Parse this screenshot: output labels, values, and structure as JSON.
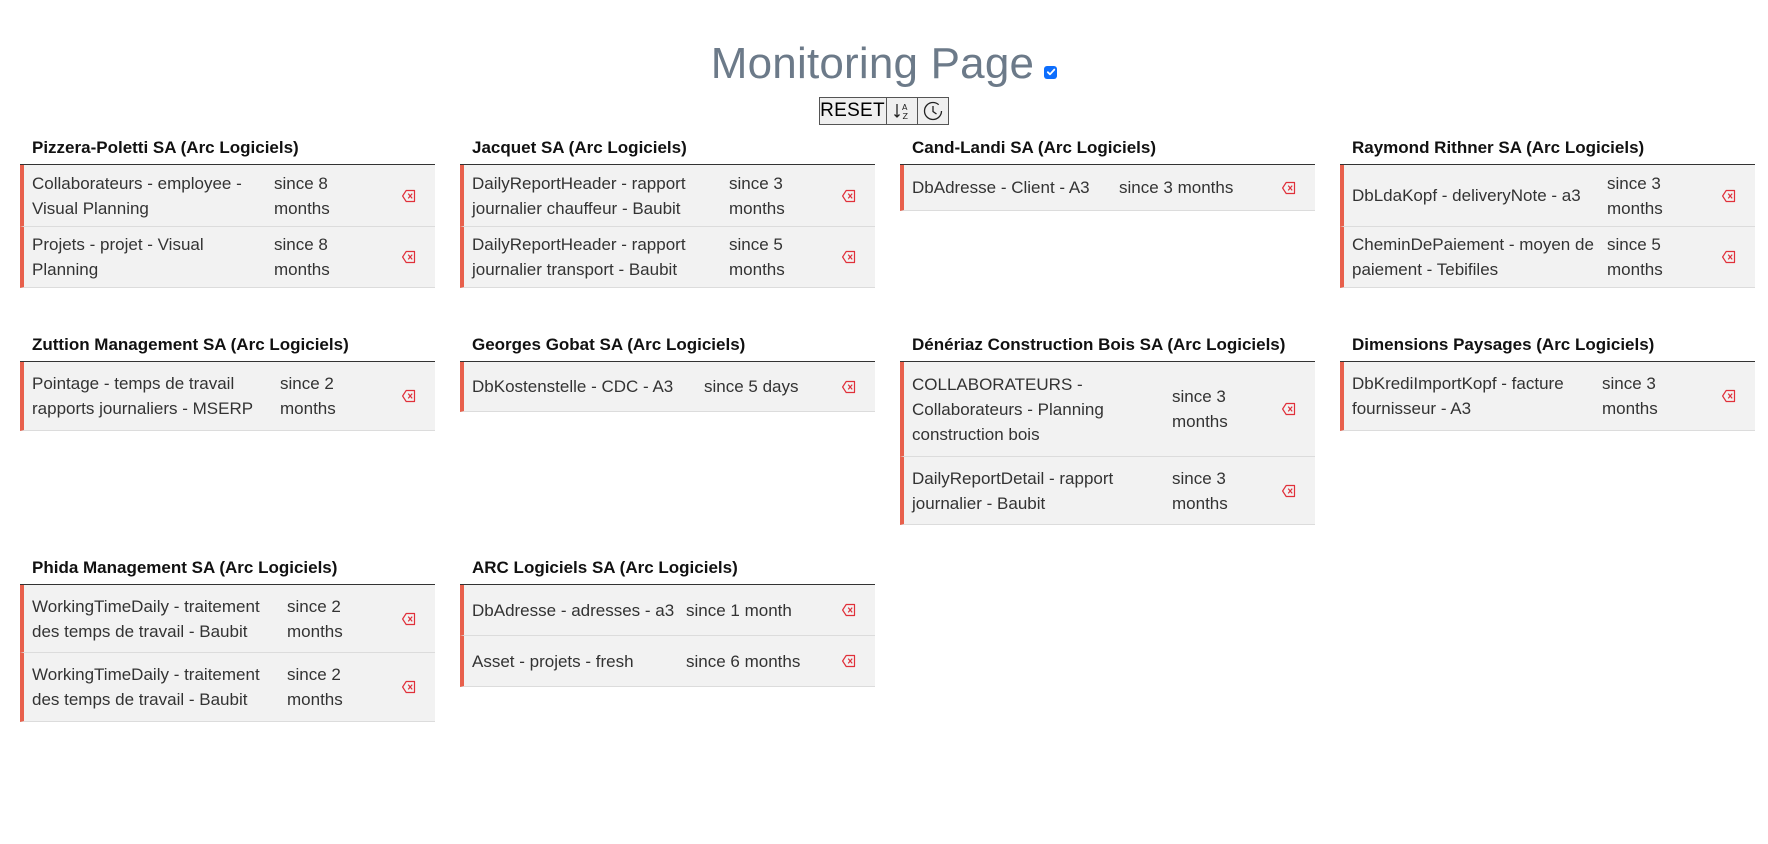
{
  "header": {
    "title": "Monitoring Page",
    "checkbox_checked": true,
    "reset_label": "RESET",
    "sort_icon": "sort-alpha-icon",
    "clock_icon": "clock-icon"
  },
  "colors": {
    "accent": "#e8604c",
    "title": "#6c7a89",
    "checkbox": "#0d6efd",
    "row_bg": "#f2f2f2"
  },
  "panels": [
    {
      "title": "Pizzera-Poletti SA (Arc Logiciels)",
      "items": [
        {
          "name": "Collaborateurs - employee - Visual Planning",
          "since": "since 8 months"
        },
        {
          "name": "Projets - projet - Visual Planning",
          "since": "since 8 months"
        }
      ]
    },
    {
      "title": "Jacquet SA (Arc Logiciels)",
      "items": [
        {
          "name": "DailyReportHeader - rapport journalier chauffeur - Baubit",
          "since": "since 3 months"
        },
        {
          "name": "DailyReportHeader - rapport journalier transport - Baubit",
          "since": "since 5 months"
        }
      ]
    },
    {
      "title": "Cand-Landi SA (Arc Logiciels)",
      "items": [
        {
          "name": "DbAdresse - Client - A3",
          "since": "since 3 months"
        }
      ]
    },
    {
      "title": "Raymond Rithner SA (Arc Logiciels)",
      "items": [
        {
          "name": "DbLdaKopf - deliveryNote - a3",
          "since": "since 3 months"
        },
        {
          "name": "CheminDePaiement - moyen de paiement - Tebifiles",
          "since": "since 5 months"
        }
      ]
    },
    {
      "title": "Zuttion Management SA (Arc Logiciels)",
      "items": [
        {
          "name": "Pointage - temps de travail rapports journaliers - MSERP",
          "since": "since 2 months"
        }
      ]
    },
    {
      "title": "Georges Gobat SA (Arc Logiciels)",
      "items": [
        {
          "name": "DbKostenstelle - CDC - A3",
          "since": "since 5 days"
        }
      ]
    },
    {
      "title": "Dénériaz Construction Bois SA (Arc Logiciels)",
      "items": [
        {
          "name": "COLLABORATEURS - Collaborateurs - Planning construction bois",
          "since": "since 3 months"
        },
        {
          "name": "DailyReportDetail - rapport journalier - Baubit",
          "since": "since 3 months"
        }
      ]
    },
    {
      "title": "Dimensions Paysages (Arc Logiciels)",
      "items": [
        {
          "name": "DbKrediImportKopf - facture fournisseur - A3",
          "since": "since 3 months"
        }
      ]
    },
    {
      "title": "Phida Management SA (Arc Logiciels)",
      "items": [
        {
          "name": "WorkingTimeDaily - traitement des temps de travail - Baubit",
          "since": "since 2 months"
        },
        {
          "name": "WorkingTimeDaily - traitement des temps de travail - Baubit",
          "since": "since 2 months"
        }
      ]
    },
    {
      "title": "ARC Logiciels SA (Arc Logiciels)",
      "items": [
        {
          "name": "DbAdresse - adresses - a3",
          "since": "since 1 month"
        },
        {
          "name": "Asset - projets - fresh",
          "since": "since 6 months"
        }
      ]
    }
  ]
}
